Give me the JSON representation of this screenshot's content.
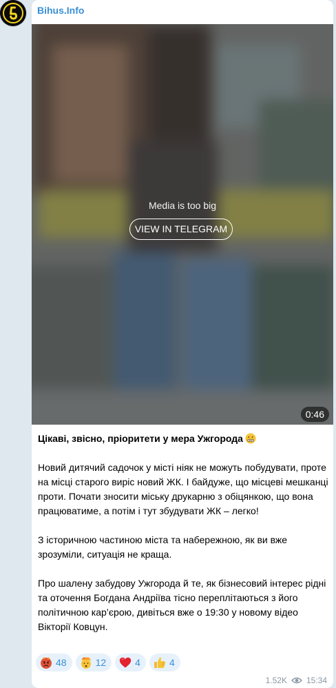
{
  "channel": {
    "name": "Bihus.Info"
  },
  "media": {
    "message": "Media is too big",
    "button_label": "VIEW IN TELEGRAM",
    "duration": "0:46"
  },
  "post": {
    "title": "Цікаві, звісно, пріоритети у мера Ужгорода",
    "title_emoji": "grimacing-face-icon",
    "paragraphs": [
      "Новий дитячий садочок у місті ніяк не можуть побудувати, проте на місці старого виріс новий ЖК. І байдуже, що місцеві мешканці проти. Почати зносити міську друкарню з обіцянкою, що вона працюватиме, а потім і тут збудувати ЖК – легко!",
      "З історичною частиною міста та набережною, як ви вже зрозуміли, ситуація не краща.",
      "Про шалену забудову Ужгорода й те, як бізнесовий інтерес рідні та оточення Богдана Андріїва тісно переплітаються з його політичною кар’єрою, дивіться вже о 19:30 у новому відео Вікторії Ковцун."
    ]
  },
  "reactions": [
    {
      "icon": "angry-face-icon",
      "count": "48"
    },
    {
      "icon": "exploding-head-icon",
      "count": "12"
    },
    {
      "icon": "red-heart-icon",
      "count": "4"
    },
    {
      "icon": "thumbs-up-icon",
      "count": "4"
    }
  ],
  "meta": {
    "views": "1.52K",
    "time": "15:34"
  },
  "colors": {
    "accent": "#3a8fd5",
    "background": "#dfe8ee",
    "reaction_bg": "#e6f1fb",
    "logo_yellow": "#f5d51d"
  }
}
